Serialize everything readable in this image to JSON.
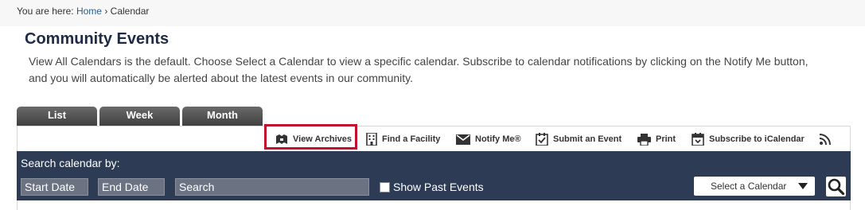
{
  "breadcrumb": {
    "prefix": "You are here:",
    "home": "Home",
    "separator": "›",
    "current": "Calendar"
  },
  "page": {
    "title": "Community Events",
    "intro_line1": "View All Calendars is the default. Choose Select a Calendar to view a specific calendar. Subscribe to calendar notifications by clicking on the Notify Me button,",
    "intro_line2": "and you will automatically be alerted about the latest events in our community."
  },
  "tabs": [
    "List",
    "Week",
    "Month"
  ],
  "toolbar": {
    "view_archives": "View Archives",
    "find_facility": "Find a Facility",
    "notify_me": "Notify Me®",
    "submit_event": "Submit an Event",
    "print": "Print",
    "subscribe": "Subscribe to iCalendar"
  },
  "search": {
    "label": "Search calendar by:",
    "start_date": "Start Date",
    "end_date": "End Date",
    "search_placeholder": "Search",
    "show_past": "Show Past Events",
    "select_calendar": "Select a Calendar"
  },
  "colors": {
    "panel": "#2d3b55",
    "highlight": "#c4102e",
    "link": "#2a5d8f"
  }
}
